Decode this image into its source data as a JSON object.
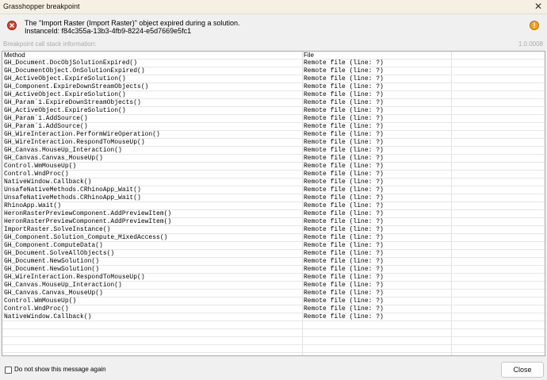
{
  "window": {
    "title": "Grasshopper breakpoint",
    "close_glyph": "✕"
  },
  "header": {
    "message_line1": "The \"Import Raster (Import Raster)\" object expired during a solution.",
    "message_line2": "InstanceId: f84c355a-13b3-4fb9-8224-e5d7669e5fc1",
    "warning_glyph": "!"
  },
  "stack": {
    "label": "Breakpoint call stack information:",
    "version": "1.0.0008",
    "columns": [
      "Method",
      "File"
    ],
    "rows": [
      [
        "GH_Document.DocObjSolutionExpired()",
        "Remote file (line: ?)"
      ],
      [
        "GH_DocumentObject.OnSolutionExpired()",
        "Remote file (line: ?)"
      ],
      [
        "GH_ActiveObject.ExpireSolution()",
        "Remote file (line: ?)"
      ],
      [
        "GH_Component.ExpireDownStreamObjects()",
        "Remote file (line: ?)"
      ],
      [
        "GH_ActiveObject.ExpireSolution()",
        "Remote file (line: ?)"
      ],
      [
        "GH_Param`1.ExpireDownStreamObjects()",
        "Remote file (line: ?)"
      ],
      [
        "GH_ActiveObject.ExpireSolution()",
        "Remote file (line: ?)"
      ],
      [
        "GH_Param`1.AddSource()",
        "Remote file (line: ?)"
      ],
      [
        "GH_Param`1.AddSource()",
        "Remote file (line: ?)"
      ],
      [
        "GH_WireInteraction.PerformWireOperation()",
        "Remote file (line: ?)"
      ],
      [
        "GH_WireInteraction.RespondToMouseUp()",
        "Remote file (line: ?)"
      ],
      [
        "GH_Canvas.MouseUp_Interaction()",
        "Remote file (line: ?)"
      ],
      [
        "GH_Canvas.Canvas_MouseUp()",
        "Remote file (line: ?)"
      ],
      [
        "Control.WmMouseUp()",
        "Remote file (line: ?)"
      ],
      [
        "Control.WndProc()",
        "Remote file (line: ?)"
      ],
      [
        "NativeWindow.Callback()",
        "Remote file (line: ?)"
      ],
      [
        "UnsafeNativeMethods.CRhinoApp_Wait()",
        "Remote file (line: ?)"
      ],
      [
        "UnsafeNativeMethods.CRhinoApp_Wait()",
        "Remote file (line: ?)"
      ],
      [
        "RhinoApp.Wait()",
        "Remote file (line: ?)"
      ],
      [
        "HeronRasterPreviewComponent.AddPreviewItem()",
        "Remote file (line: ?)"
      ],
      [
        "HeronRasterPreviewComponent.AddPreviewItem()",
        "Remote file (line: ?)"
      ],
      [
        "ImportRaster.SolveInstance()",
        "Remote file (line: ?)"
      ],
      [
        "GH_Component.Solution_Compute_MixedAccess()",
        "Remote file (line: ?)"
      ],
      [
        "GH_Component.ComputeData()",
        "Remote file (line: ?)"
      ],
      [
        "GH_Document.SolveAllObjects()",
        "Remote file (line: ?)"
      ],
      [
        "GH_Document.NewSolution()",
        "Remote file (line: ?)"
      ],
      [
        "GH_Document.NewSolution()",
        "Remote file (line: ?)"
      ],
      [
        "GH_WireInteraction.RespondToMouseUp()",
        "Remote file (line: ?)"
      ],
      [
        "GH_Canvas.MouseUp_Interaction()",
        "Remote file (line: ?)"
      ],
      [
        "GH_Canvas.Canvas_MouseUp()",
        "Remote file (line: ?)"
      ],
      [
        "Control.WmMouseUp()",
        "Remote file (line: ?)"
      ],
      [
        "Control.WndProc()",
        "Remote file (line: ?)"
      ],
      [
        "NativeWindow.Callback()",
        "Remote file (line: ?)"
      ]
    ],
    "empty_rows": 4
  },
  "footer": {
    "checkbox_label": "Do not show this message again",
    "checkbox_checked": false,
    "close_label": "Close"
  },
  "icons": {
    "error": "error-icon",
    "warning": "warning-icon"
  },
  "colors": {
    "titlebar": "#f6efe4",
    "error": "#d9412c",
    "warning": "#f0a11e"
  }
}
